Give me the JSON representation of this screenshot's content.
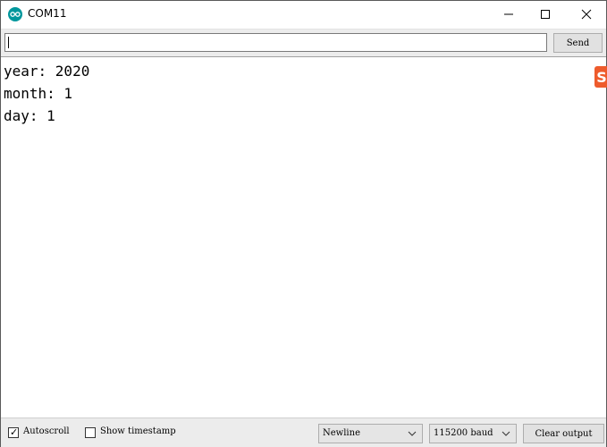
{
  "window": {
    "title": "COM11",
    "icon": "arduino-icon",
    "controls": {
      "minimize_icon": "minimize-icon",
      "maximize_icon": "maximize-icon",
      "close_icon": "close-icon"
    }
  },
  "send_bar": {
    "input_value": "",
    "send_label": "Send"
  },
  "output": {
    "lines": [
      "year: 2020",
      "month: 1",
      "day: 1"
    ]
  },
  "overlay_badge": {
    "letter": "S",
    "color": "#ee5b2c"
  },
  "footer": {
    "autoscroll": {
      "label": "Autoscroll",
      "checked": true
    },
    "show_timestamp": {
      "label": "Show timestamp",
      "checked": false
    },
    "line_ending": {
      "selected": "Newline"
    },
    "baud_rate": {
      "selected": "115200 baud"
    },
    "clear_label": "Clear output"
  },
  "colors": {
    "accent_badge": "#ee5b2c",
    "arduino_teal": "#00979c"
  }
}
